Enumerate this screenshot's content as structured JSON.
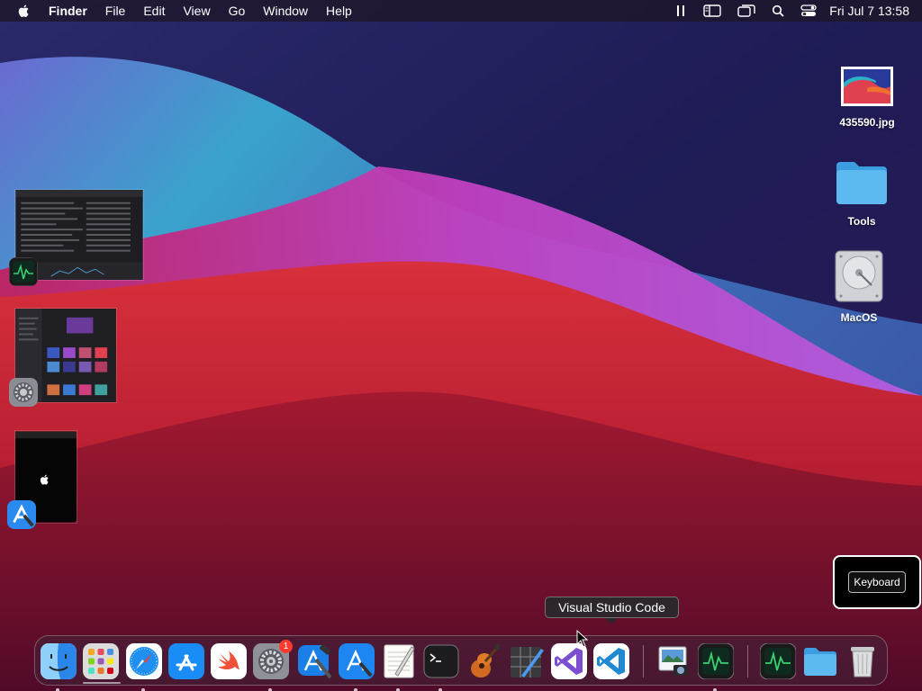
{
  "menubar": {
    "app_name": "Finder",
    "menus": [
      "File",
      "Edit",
      "View",
      "Go",
      "Window",
      "Help"
    ],
    "status_icons": [
      "pause-bars-icon",
      "sidebar-icon",
      "screen-mirror-icon",
      "spotlight-search-icon",
      "control-center-icon"
    ],
    "clock": "Fri Jul 7  13:58"
  },
  "desktop_icons": [
    {
      "label": "435590.jpg",
      "icon": "image-file-icon"
    },
    {
      "label": "Tools",
      "icon": "folder-icon"
    },
    {
      "label": "MacOS",
      "icon": "hard-drive-icon"
    }
  ],
  "window_thumbnails": [
    {
      "app": "activity-monitor-icon"
    },
    {
      "app": "system-preferences-icon"
    },
    {
      "app": "xcode-simulator-icon"
    }
  ],
  "keyboard_widget": {
    "label": "Keyboard"
  },
  "tooltip": {
    "text": "Visual Studio Code"
  },
  "dock": {
    "items": [
      {
        "name": "finder",
        "icon": "finder-icon",
        "running": true
      },
      {
        "name": "launchpad",
        "icon": "launchpad-icon",
        "running": false
      },
      {
        "name": "safari",
        "icon": "safari-icon",
        "running": true
      },
      {
        "name": "app-store",
        "icon": "app-store-icon",
        "running": false
      },
      {
        "name": "swift-playgrounds",
        "icon": "swift-icon",
        "running": false
      },
      {
        "name": "system-preferences",
        "icon": "system-preferences-icon",
        "running": true,
        "badge": "1"
      },
      {
        "name": "xcode",
        "icon": "xcode-icon",
        "running": false
      },
      {
        "name": "simulator",
        "icon": "simulator-icon",
        "running": true
      },
      {
        "name": "textedit",
        "icon": "textedit-icon",
        "running": true
      },
      {
        "name": "terminal",
        "icon": "terminal-icon",
        "running": true
      },
      {
        "name": "garageband",
        "icon": "garageband-icon",
        "running": false
      },
      {
        "name": "instruments",
        "icon": "instruments-icon",
        "running": false
      },
      {
        "name": "visual-studio",
        "icon": "visual-studio-icon",
        "running": false
      },
      {
        "name": "visual-studio-code",
        "icon": "vscode-icon",
        "running": false
      },
      {
        "name": "preview",
        "icon": "preview-icon",
        "running": false
      },
      {
        "name": "activity-monitor",
        "icon": "activity-monitor-icon",
        "running": true
      },
      {
        "name": "activity-monitor-minimized",
        "icon": "activity-monitor-icon",
        "running": false
      },
      {
        "name": "downloads-folder",
        "icon": "folder-icon",
        "running": false
      },
      {
        "name": "trash",
        "icon": "trash-icon",
        "running": false
      }
    ]
  },
  "colors": {
    "wall_navy": "#1c1f5c",
    "wall_teal": "#3aa0c8",
    "wall_red": "#c8283a",
    "wall_purple": "#b050d0",
    "accent_blue": "#1e88e5"
  }
}
